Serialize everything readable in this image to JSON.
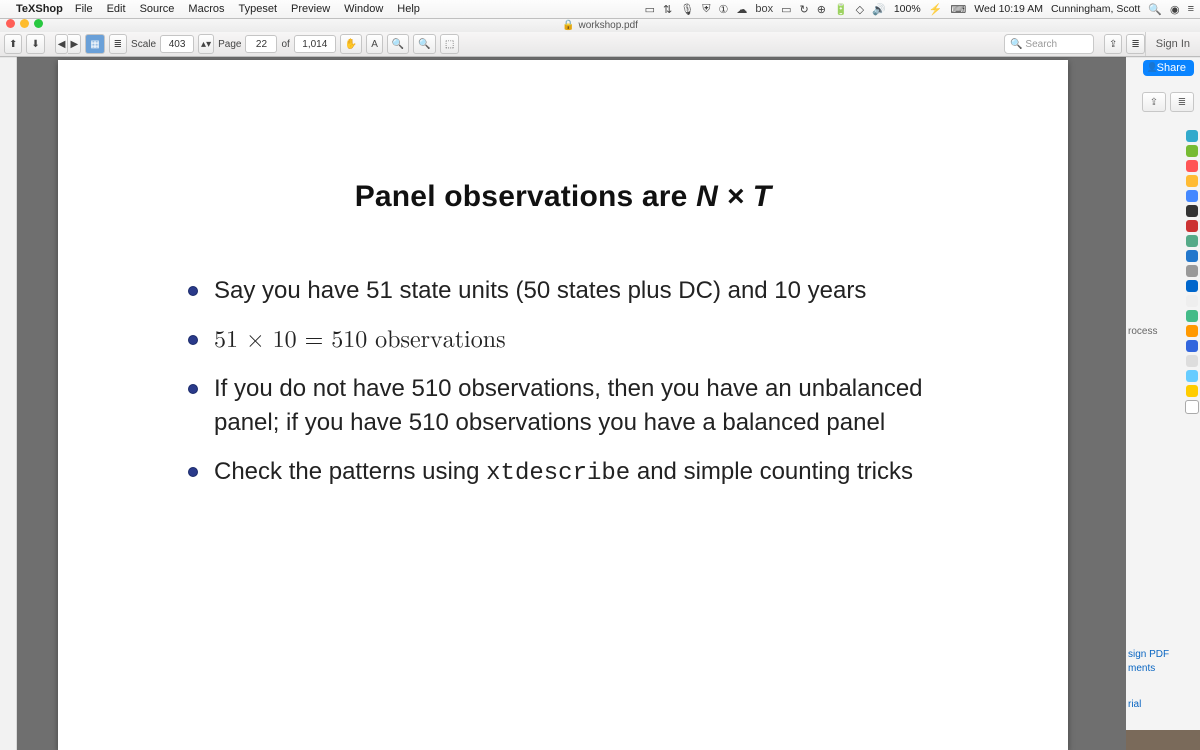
{
  "menubar": {
    "app": "TeXShop",
    "items": [
      "File",
      "Edit",
      "Source",
      "Macros",
      "Typeset",
      "Preview",
      "Window",
      "Help"
    ],
    "battery": "100%",
    "clock": "Wed 10:19 AM",
    "user": "Cunningham, Scott"
  },
  "window": {
    "title": "workshop.pdf",
    "lock_icon": "🔒"
  },
  "toolbar": {
    "scale_label": "Scale",
    "scale_value": "403",
    "page_label": "Page",
    "page_value": "22",
    "of_label": "of",
    "page_total": "1,014",
    "search_placeholder": "Search",
    "signin": "Sign In"
  },
  "rightpanel": {
    "share": "Share",
    "link1": "rocess",
    "link2": "sign PDF",
    "link3": "ments",
    "link4": "rial"
  },
  "slide": {
    "title_plain": "Panel observations are ",
    "title_math": "N × T",
    "b1": "Say you have 51 state units (50 states plus DC) and 10 years",
    "b2_pre": "51 × 10 = 510 observations",
    "b3": "If you do not have 510 observations, then you have an unbalanced panel; if you have 510 observations you have a balanced panel",
    "b4_pre": "Check the patterns using ",
    "b4_code": "xtdescribe",
    "b4_post": " and simple counting tricks"
  }
}
